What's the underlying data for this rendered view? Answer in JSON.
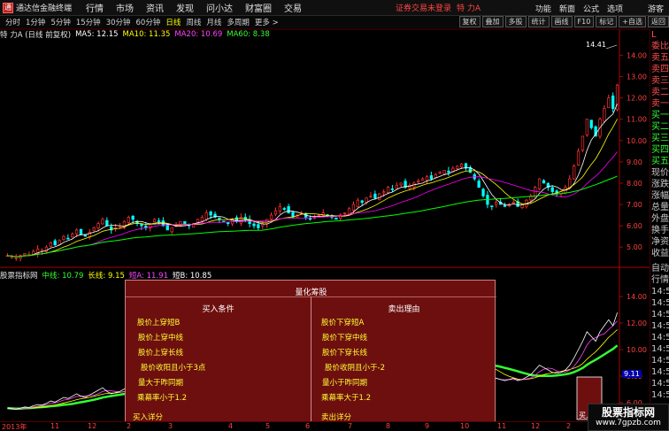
{
  "app": {
    "logo_glyph": "通",
    "title": "通达信金融终端",
    "menu": [
      "行情",
      "市场",
      "资讯",
      "发现",
      "问小达",
      "财富圈",
      "交易"
    ],
    "login_warning": "证券交易未登录",
    "stock_name": "特 力A",
    "right_menu": [
      "功能",
      "新面",
      "公式",
      "选项"
    ],
    "guest": "游客"
  },
  "toolbar": {
    "periods": [
      "分时",
      "1分钟",
      "5分钟",
      "15分钟",
      "30分钟",
      "60分钟",
      "日线",
      "周线",
      "月线",
      "多周期",
      "更多 >"
    ],
    "active_period": "日线",
    "right_buttons": [
      "复权",
      "叠加",
      "多股",
      "统计",
      "画线",
      "F10",
      "标记",
      "+自选",
      "返回"
    ]
  },
  "main_info": {
    "stock_label": "特 力A (日线 前复权)",
    "ma5": "MA5: 12.15",
    "ma10": "MA10: 11.35",
    "ma20": "MA20: 10.69",
    "ma60": "MA60: 8.38",
    "high_marker": "14.41"
  },
  "indicator_info": {
    "name": "股票指标网",
    "mid": "中线: 10.79",
    "long": "长线: 9.15",
    "shortA": "短A: 11.91",
    "shortB": "短B: 10.85",
    "current_value": "9.11"
  },
  "price_axis": {
    "main_labels": [
      "14.00",
      "13.00",
      "12.00",
      "11.00",
      "10.00",
      "9.00",
      "8.00",
      "7.00",
      "6.00",
      "5.00"
    ],
    "ind_labels": [
      "14.00",
      "12.00",
      "10.00",
      "8.00",
      "6.00"
    ]
  },
  "right_panel": {
    "top_items": [
      "委比",
      "卖五",
      "卖四",
      "卖三",
      "卖二",
      "卖一",
      "买一",
      "买二",
      "买三",
      "买四",
      "买五",
      "现价",
      "涨跌",
      "涨幅",
      "总量",
      "外盘",
      "换手",
      "净资",
      "收益"
    ],
    "bottom_items": [
      "自动",
      "行情",
      "14:5",
      "14:5",
      "14:5",
      "14:5",
      "14:5",
      "14:5",
      "14:5",
      "14:5",
      "14:5",
      "14:5"
    ],
    "corner": "L"
  },
  "popup": {
    "title": "量化筹股",
    "buy_header": "买入条件",
    "sell_header": "卖出理由",
    "buy_conditions": [
      "股价上穿短B",
      "股价上穿中线",
      "股价上穿长线",
      "股价收阳且小于3点",
      "量大于昨同期",
      "乘幕率小于1.2"
    ],
    "sell_conditions": [
      "股价下穿短A",
      "股价下穿中线",
      "股价下穿长线",
      "股价收阴且小于-2",
      "量小于昨同期",
      "乘幕率大于1.2"
    ],
    "buy_footer": "买入详分",
    "sell_footer": "卖出详分"
  },
  "buy_signal_label": "买入详分",
  "x_axis": {
    "labels": [
      "2013年",
      "11",
      "12",
      "2",
      "3",
      "4",
      "5",
      "6",
      "7",
      "8",
      "9",
      "10",
      "11",
      "12",
      "2",
      "3"
    ]
  },
  "watermark": {
    "title": "股票指标网",
    "url": "www.7gpzb.com"
  },
  "colors": {
    "ma5": "#ffffff",
    "ma10": "#ffff00",
    "ma20": "#ff00ff",
    "ma60": "#00ff00",
    "up": "#ff3030",
    "down": "#00ffff",
    "accent_red": "#ff3030"
  },
  "chart_data": {
    "type": "candlestick",
    "series_close": [
      4.6,
      4.55,
      4.5,
      4.6,
      4.7,
      4.65,
      4.8,
      4.9,
      4.85,
      5.0,
      5.2,
      5.1,
      5.3,
      5.5,
      5.4,
      5.6,
      5.8,
      5.6,
      5.5,
      5.7,
      5.9,
      6.1,
      6.3,
      6.0,
      5.8,
      5.9,
      6.0,
      6.2,
      6.4,
      6.3,
      6.1,
      6.0,
      5.9,
      6.1,
      6.3,
      6.2,
      6.0,
      5.8,
      5.9,
      6.0,
      6.2,
      6.1,
      6.0,
      6.1,
      6.3,
      6.4,
      6.6,
      6.5,
      6.4,
      6.3,
      6.2,
      6.1,
      6.3,
      6.2,
      6.4,
      6.3,
      6.1,
      6.0,
      5.9,
      6.1,
      6.3,
      6.5,
      6.7,
      6.9,
      6.8,
      6.6,
      6.4,
      6.5,
      6.6,
      6.4,
      6.3,
      6.4,
      6.5,
      6.6,
      6.5,
      6.4,
      6.3,
      6.5,
      6.6,
      6.8,
      7.0,
      7.2,
      7.1,
      7.3,
      7.4,
      7.3,
      7.5,
      7.6,
      7.8,
      7.7,
      7.9,
      8.0,
      7.8,
      7.9,
      8.0,
      8.1,
      8.2,
      8.3,
      8.2,
      8.4,
      8.5,
      8.6,
      8.5,
      8.7,
      8.8,
      8.9,
      8.7,
      8.5,
      8.2,
      7.8,
      7.4,
      7.0,
      6.9,
      7.1,
      7.0,
      6.9,
      7.0,
      7.1,
      6.9,
      7.0,
      7.2,
      7.4,
      7.8,
      8.2,
      8.0,
      7.8,
      7.6,
      7.5,
      7.6,
      7.8,
      8.2,
      8.8,
      9.5,
      10.2,
      11.0,
      10.6,
      10.2,
      11.0,
      11.5,
      12.0,
      11.5,
      12.6
    ],
    "ylim": [
      4.3,
      14.6
    ],
    "x_labels": [
      "2013年",
      "11",
      "12",
      "2",
      "3",
      "4",
      "5",
      "6",
      "7",
      "8",
      "9",
      "10",
      "11",
      "12",
      "2",
      "3"
    ]
  }
}
